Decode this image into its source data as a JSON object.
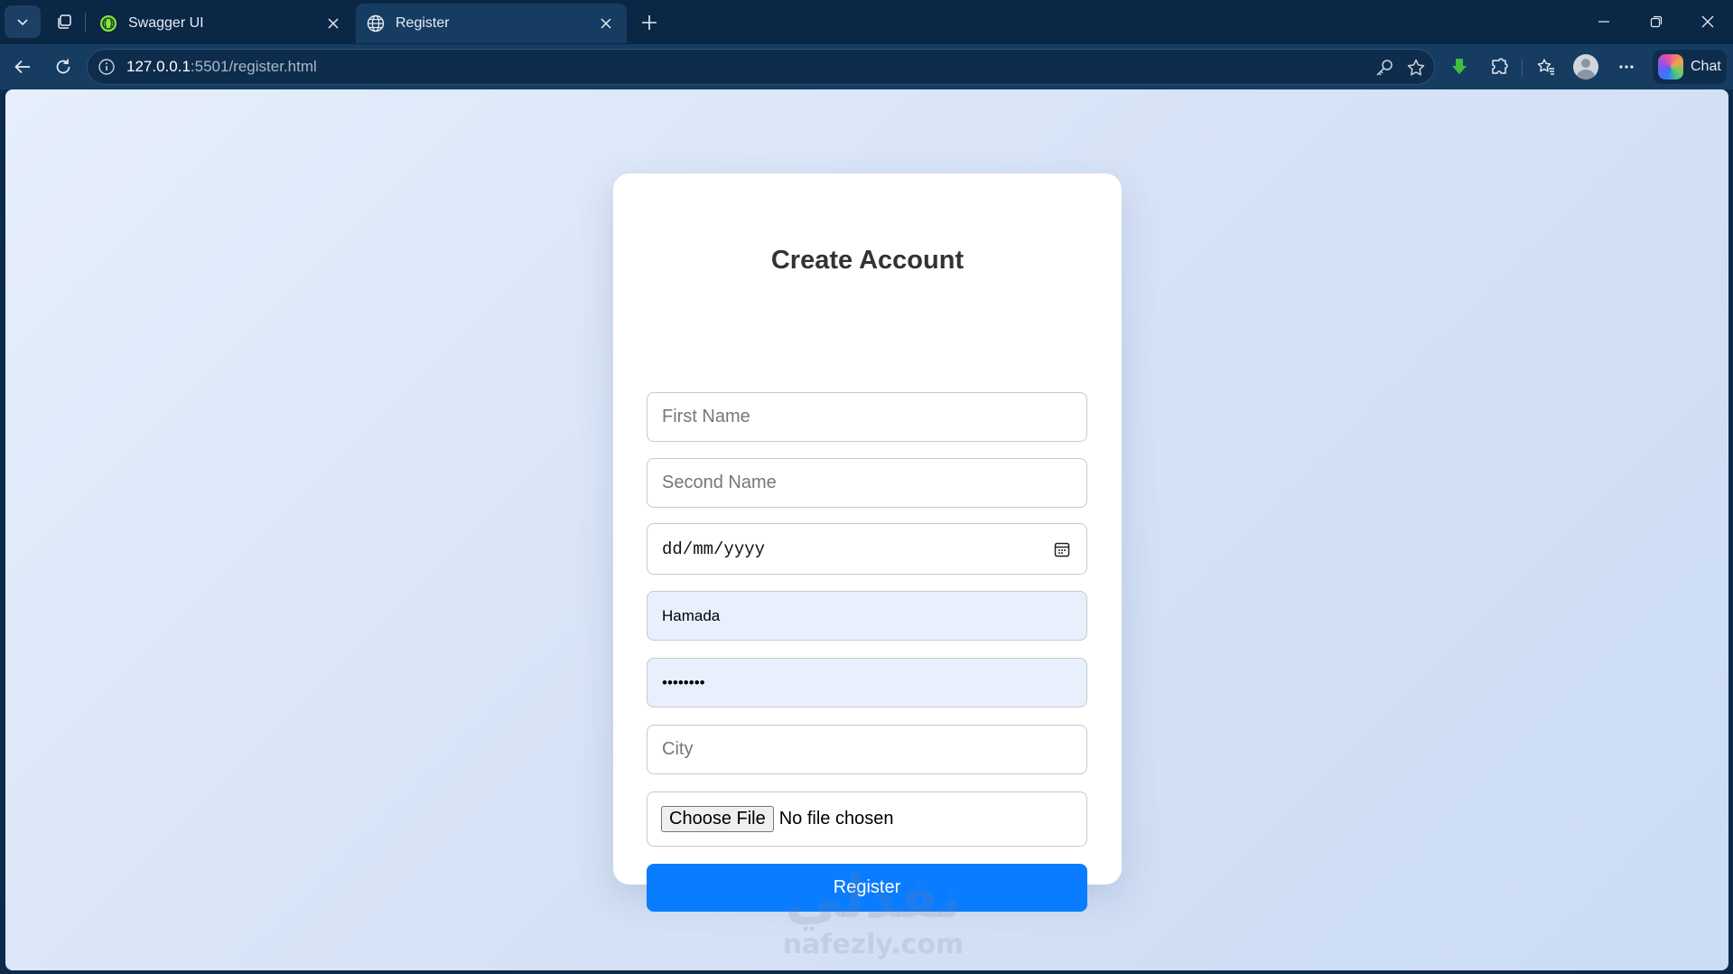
{
  "browser": {
    "tabs": [
      {
        "label": "Swagger UI",
        "active": false
      },
      {
        "label": "Register",
        "active": true
      }
    ],
    "url": {
      "host": "127.0.0.1",
      "rest": ":5501/register.html"
    },
    "chat_label": "Chat"
  },
  "form": {
    "title": "Create Account",
    "first_name_placeholder": "First Name",
    "second_name_placeholder": "Second Name",
    "date_placeholder": "dd/mm/yyyy",
    "username_value": "Hamada",
    "password_value": "••••••••",
    "city_placeholder": "City",
    "choose_file_label": "Choose File",
    "file_status": "No file chosen",
    "register_label": "Register"
  },
  "watermark": {
    "arabic": "نفذلي",
    "latin": "nafezly.com"
  },
  "colors": {
    "accent": "#0a7cff",
    "autofill": "#e8f0fe",
    "chrome": "#173c62"
  }
}
